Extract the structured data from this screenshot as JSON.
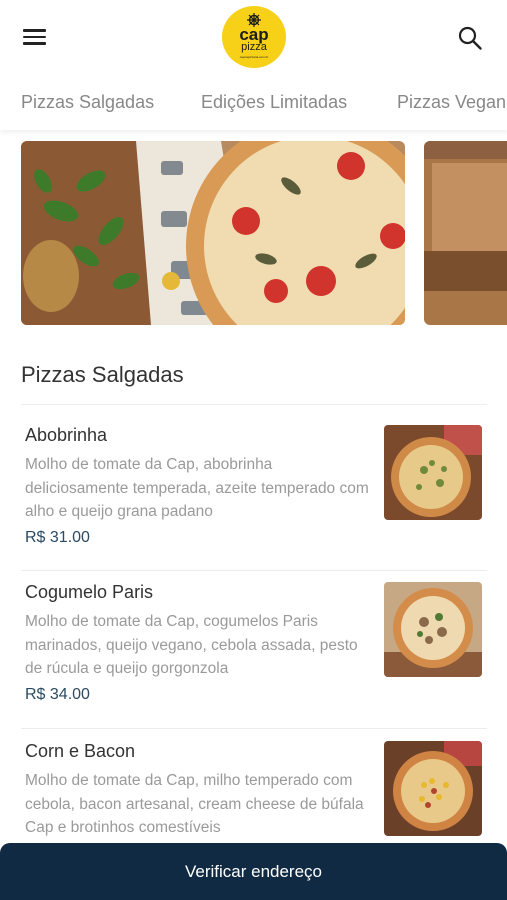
{
  "header": {
    "logo_line1": "cap",
    "logo_line2": "pizza",
    "logo_line3": "capnapizzaria.com.br"
  },
  "tabs": [
    {
      "label": "Pizzas Salgadas"
    },
    {
      "label": "Edições Limitadas"
    },
    {
      "label": "Pizzas Veganas"
    }
  ],
  "section": {
    "title": "Pizzas Salgadas"
  },
  "items": [
    {
      "name": "Abobrinha",
      "description": "Molho de tomate da Cap, abobrinha deliciosamente temperada, azeite temperado com alho e queijo grana padano",
      "price": "R$ 31.00"
    },
    {
      "name": "Cogumelo Paris",
      "description": "Molho de tomate da Cap, cogumelos Paris marinados, queijo vegano, cebola assada, pesto de rúcula e queijo gorgonzola",
      "price": "R$ 34.00"
    },
    {
      "name": "Corn e Bacon",
      "description": "Molho de tomate da Cap, milho temperado com cebola, bacon artesanal, cream cheese de búfala Cap e brotinhos comestíveis",
      "price": ""
    }
  ],
  "footer": {
    "button_label": "Verificar endereço"
  },
  "colors": {
    "brand_yellow": "#f7d117",
    "dark_navy": "#0f2a42",
    "price": "#2b4a63"
  }
}
